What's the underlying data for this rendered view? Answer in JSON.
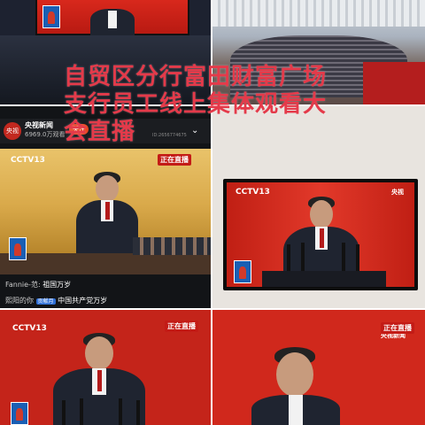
{
  "overlay": {
    "line1": "自贸区分行富田财富广场",
    "line2": "支行员工线上集体观看大",
    "line3": "会直播"
  },
  "phone": {
    "channel_name": "央视新闻",
    "viewers": "6969.0万观看",
    "follow_label": "关注",
    "id_text": "ID:2656774675",
    "cctv_logo": "CCTV13",
    "live_badge": "正在直播",
    "comment1_user": "Fannie-范:",
    "comment1_text": "祖国万岁",
    "comment2_user": "熙阳的你",
    "comment2_badge": "贡献月",
    "comment2_text": "中国共产党万岁"
  },
  "tv": {
    "cctv_logo": "CCTV13",
    "corner_logo": "央视"
  },
  "bottom_left": {
    "cctv_logo": "CCTV13",
    "live_badge": "正在直播"
  },
  "bottom_right": {
    "channel": "央视新闻",
    "live_badge": "正在直播"
  },
  "colors": {
    "overlay_text": "#e43a4a",
    "stage_red": "#d0281c",
    "phone_bg": "#121417"
  }
}
